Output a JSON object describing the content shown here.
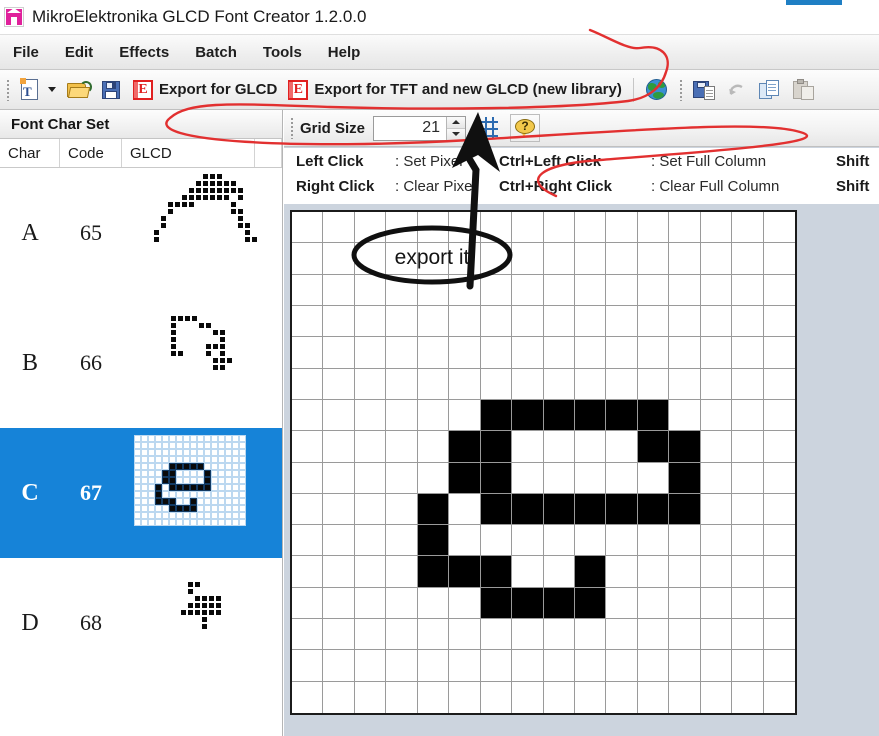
{
  "window": {
    "title": "MikroElektronika GLCD Font Creator 1.2.0.0",
    "icon": "app-house-icon"
  },
  "menu": {
    "items": [
      {
        "label": "File"
      },
      {
        "label": "Edit"
      },
      {
        "label": "Effects"
      },
      {
        "label": "Batch"
      },
      {
        "label": "Tools"
      },
      {
        "label": "Help"
      }
    ]
  },
  "toolbar": {
    "new_font_icon": "new-font-icon",
    "open_icon": "open-folder-icon",
    "save_icon": "save-floppy-icon",
    "export_glcd_icon": "export-e-icon",
    "export_glcd_label": "Export for GLCD",
    "export_tft_icon": "export-e-icon",
    "export_tft_label": "Export for TFT and new GLCD (new library)",
    "globe_icon": "globe-icon",
    "save_as_icon": "save-as-icon",
    "undo_icon": "undo-arrow-icon",
    "copy_icon": "copy-icon",
    "paste_icon": "paste-icon"
  },
  "left_panel": {
    "header": "Font Char Set",
    "columns": [
      "Char",
      "Code",
      "GLCD"
    ],
    "rows": [
      {
        "char": "A",
        "code": "65",
        "selected": false
      },
      {
        "char": "B",
        "code": "66",
        "selected": false
      },
      {
        "char": "C",
        "code": "67",
        "selected": true
      },
      {
        "char": "D",
        "code": "68",
        "selected": false
      }
    ]
  },
  "grid_toolbar": {
    "grid_size_label": "Grid Size",
    "grid_size_value": "21",
    "grid_toggle_icon": "grid-toggle-icon",
    "help_icon": "help-question-icon"
  },
  "hints": {
    "rows": [
      {
        "key1": "Left Click",
        "val1": ": Set Pixel",
        "key2": "Ctrl+Left Click",
        "val2": ": Set Full Column",
        "key3": "Shift"
      },
      {
        "key1": "Right Click",
        "val1": ": Clear Pixel",
        "key2": "Ctrl+Right Click",
        "val2": ": Clear Full Column",
        "key3": "Shift"
      }
    ]
  },
  "annotation": {
    "callout_text": "export it",
    "ink_color": "#e02020",
    "pen_color": "#101010"
  },
  "colors": {
    "selection_blue": "#1683d8",
    "pixel_on": "#000000",
    "pixel_off": "#ffffff",
    "canvas_bg": "#ccd4de"
  },
  "glyph_grid": {
    "cols": 16,
    "rows": 16,
    "on_cells": [
      [
        6,
        6
      ],
      [
        6,
        7
      ],
      [
        6,
        8
      ],
      [
        6,
        9
      ],
      [
        6,
        10
      ],
      [
        6,
        11
      ],
      [
        7,
        5
      ],
      [
        7,
        6
      ],
      [
        7,
        11
      ],
      [
        7,
        12
      ],
      [
        8,
        5
      ],
      [
        8,
        6
      ],
      [
        8,
        12
      ],
      [
        9,
        4
      ],
      [
        9,
        6
      ],
      [
        9,
        7
      ],
      [
        9,
        8
      ],
      [
        9,
        9
      ],
      [
        9,
        10
      ],
      [
        9,
        11
      ],
      [
        9,
        12
      ],
      [
        10,
        4
      ],
      [
        11,
        4
      ],
      [
        11,
        5
      ],
      [
        11,
        6
      ],
      [
        11,
        9
      ],
      [
        12,
        6
      ],
      [
        12,
        7
      ],
      [
        12,
        8
      ],
      [
        12,
        9
      ]
    ]
  },
  "mini_glyphs": {
    "A": {
      "cols": 16,
      "rows": 14,
      "on_cells": [
        [
          0,
          8
        ],
        [
          0,
          9
        ],
        [
          0,
          10
        ],
        [
          1,
          7
        ],
        [
          1,
          8
        ],
        [
          1,
          9
        ],
        [
          1,
          10
        ],
        [
          1,
          11
        ],
        [
          1,
          12
        ],
        [
          2,
          6
        ],
        [
          2,
          7
        ],
        [
          2,
          8
        ],
        [
          2,
          9
        ],
        [
          2,
          10
        ],
        [
          2,
          11
        ],
        [
          2,
          12
        ],
        [
          2,
          13
        ],
        [
          3,
          5
        ],
        [
          3,
          6
        ],
        [
          3,
          7
        ],
        [
          3,
          8
        ],
        [
          3,
          9
        ],
        [
          3,
          10
        ],
        [
          3,
          11
        ],
        [
          3,
          13
        ],
        [
          4,
          3
        ],
        [
          4,
          4
        ],
        [
          4,
          5
        ],
        [
          4,
          6
        ],
        [
          4,
          12
        ],
        [
          5,
          3
        ],
        [
          5,
          12
        ],
        [
          5,
          13
        ],
        [
          6,
          2
        ],
        [
          6,
          13
        ],
        [
          7,
          2
        ],
        [
          7,
          13
        ],
        [
          7,
          14
        ],
        [
          8,
          1
        ],
        [
          8,
          14
        ],
        [
          9,
          1
        ],
        [
          9,
          14
        ],
        [
          9,
          15
        ]
      ]
    },
    "B": {
      "cols": 14,
      "rows": 12,
      "on_cells": [
        [
          0,
          2
        ],
        [
          0,
          3
        ],
        [
          0,
          4
        ],
        [
          0,
          5
        ],
        [
          1,
          2
        ],
        [
          1,
          6
        ],
        [
          1,
          7
        ],
        [
          2,
          2
        ],
        [
          2,
          8
        ],
        [
          2,
          9
        ],
        [
          3,
          2
        ],
        [
          3,
          9
        ],
        [
          4,
          2
        ],
        [
          4,
          7
        ],
        [
          4,
          8
        ],
        [
          4,
          9
        ],
        [
          5,
          2
        ],
        [
          5,
          3
        ],
        [
          5,
          7
        ],
        [
          5,
          9
        ],
        [
          6,
          8
        ],
        [
          6,
          9
        ],
        [
          6,
          10
        ],
        [
          7,
          8
        ],
        [
          7,
          9
        ]
      ]
    },
    "D": {
      "cols": 12,
      "rows": 12,
      "on_cells": [
        [
          0,
          3
        ],
        [
          0,
          4
        ],
        [
          1,
          3
        ],
        [
          2,
          4
        ],
        [
          2,
          5
        ],
        [
          2,
          6
        ],
        [
          2,
          7
        ],
        [
          3,
          3
        ],
        [
          3,
          4
        ],
        [
          3,
          5
        ],
        [
          3,
          6
        ],
        [
          3,
          7
        ],
        [
          4,
          2
        ],
        [
          4,
          3
        ],
        [
          4,
          4
        ],
        [
          4,
          5
        ],
        [
          4,
          6
        ],
        [
          4,
          7
        ],
        [
          5,
          5
        ],
        [
          6,
          5
        ]
      ]
    },
    "C_mini": {
      "cols": 16,
      "rows": 13,
      "on_cells": [
        [
          4,
          5
        ],
        [
          4,
          6
        ],
        [
          4,
          7
        ],
        [
          4,
          8
        ],
        [
          4,
          9
        ],
        [
          5,
          4
        ],
        [
          5,
          5
        ],
        [
          5,
          10
        ],
        [
          6,
          4
        ],
        [
          6,
          5
        ],
        [
          6,
          10
        ],
        [
          7,
          3
        ],
        [
          7,
          5
        ],
        [
          7,
          6
        ],
        [
          7,
          7
        ],
        [
          7,
          8
        ],
        [
          7,
          9
        ],
        [
          7,
          10
        ],
        [
          8,
          3
        ],
        [
          9,
          3
        ],
        [
          9,
          4
        ],
        [
          9,
          5
        ],
        [
          9,
          8
        ],
        [
          10,
          5
        ],
        [
          10,
          6
        ],
        [
          10,
          7
        ],
        [
          10,
          8
        ]
      ]
    }
  }
}
